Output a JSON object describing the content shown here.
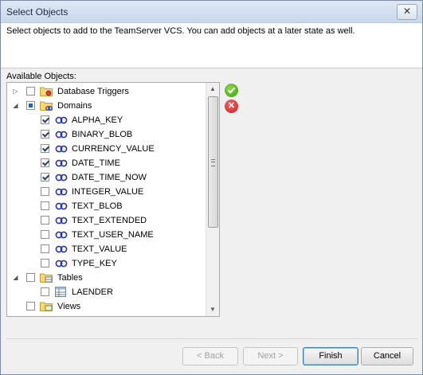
{
  "window": {
    "title": "Select Objects",
    "close_glyph": "✕"
  },
  "description": "Select objects to add to the TeamServer VCS. You can add objects at a later state as well.",
  "available_label": "Available Objects:",
  "tree": {
    "items": [
      {
        "label": "Database Triggers",
        "level": 0,
        "expander": "collapsed",
        "check": "unchecked",
        "icon": "folder-trigger-icon"
      },
      {
        "label": "Domains",
        "level": 0,
        "expander": "expanded",
        "check": "partial",
        "icon": "folder-domain-icon"
      },
      {
        "label": "ALPHA_KEY",
        "level": 1,
        "expander": "none",
        "check": "checked",
        "icon": "domain-icon"
      },
      {
        "label": "BINARY_BLOB",
        "level": 1,
        "expander": "none",
        "check": "checked",
        "icon": "domain-icon"
      },
      {
        "label": "CURRENCY_VALUE",
        "level": 1,
        "expander": "none",
        "check": "checked",
        "icon": "domain-icon"
      },
      {
        "label": "DATE_TIME",
        "level": 1,
        "expander": "none",
        "check": "checked",
        "icon": "domain-icon"
      },
      {
        "label": "DATE_TIME_NOW",
        "level": 1,
        "expander": "none",
        "check": "checked",
        "icon": "domain-icon"
      },
      {
        "label": "INTEGER_VALUE",
        "level": 1,
        "expander": "none",
        "check": "unchecked",
        "icon": "domain-icon"
      },
      {
        "label": "TEXT_BLOB",
        "level": 1,
        "expander": "none",
        "check": "unchecked",
        "icon": "domain-icon"
      },
      {
        "label": "TEXT_EXTENDED",
        "level": 1,
        "expander": "none",
        "check": "unchecked",
        "icon": "domain-icon"
      },
      {
        "label": "TEXT_USER_NAME",
        "level": 1,
        "expander": "none",
        "check": "unchecked",
        "icon": "domain-icon"
      },
      {
        "label": "TEXT_VALUE",
        "level": 1,
        "expander": "none",
        "check": "unchecked",
        "icon": "domain-icon"
      },
      {
        "label": "TYPE_KEY",
        "level": 1,
        "expander": "none",
        "check": "unchecked",
        "icon": "domain-icon"
      },
      {
        "label": "Tables",
        "level": 0,
        "expander": "expanded",
        "check": "unchecked",
        "icon": "folder-table-icon"
      },
      {
        "label": "LAENDER",
        "level": 1,
        "expander": "none",
        "check": "unchecked",
        "icon": "table-icon"
      },
      {
        "label": "Views",
        "level": 0,
        "expander": "none",
        "check": "unchecked",
        "icon": "folder-view-icon"
      }
    ]
  },
  "buttons": {
    "back": "< Back",
    "next": "Next >",
    "finish": "Finish",
    "cancel": "Cancel"
  },
  "colors": {
    "titlebar": "#c9d7ea",
    "accent": "#2a5fb3",
    "ok_green": "#3f9c16",
    "cancel_red": "#c81e1e"
  }
}
